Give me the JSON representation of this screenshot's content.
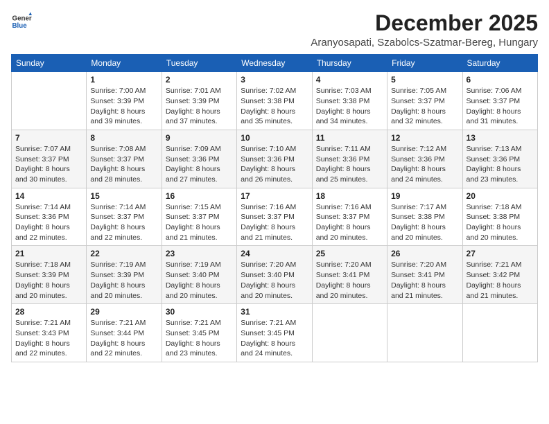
{
  "header": {
    "logo_general": "General",
    "logo_blue": "Blue",
    "month_title": "December 2025",
    "location": "Aranyosapati, Szabolcs-Szatmar-Bereg, Hungary"
  },
  "weekdays": [
    "Sunday",
    "Monday",
    "Tuesday",
    "Wednesday",
    "Thursday",
    "Friday",
    "Saturday"
  ],
  "weeks": [
    [
      {
        "day": "",
        "info": ""
      },
      {
        "day": "1",
        "info": "Sunrise: 7:00 AM\nSunset: 3:39 PM\nDaylight: 8 hours\nand 39 minutes."
      },
      {
        "day": "2",
        "info": "Sunrise: 7:01 AM\nSunset: 3:39 PM\nDaylight: 8 hours\nand 37 minutes."
      },
      {
        "day": "3",
        "info": "Sunrise: 7:02 AM\nSunset: 3:38 PM\nDaylight: 8 hours\nand 35 minutes."
      },
      {
        "day": "4",
        "info": "Sunrise: 7:03 AM\nSunset: 3:38 PM\nDaylight: 8 hours\nand 34 minutes."
      },
      {
        "day": "5",
        "info": "Sunrise: 7:05 AM\nSunset: 3:37 PM\nDaylight: 8 hours\nand 32 minutes."
      },
      {
        "day": "6",
        "info": "Sunrise: 7:06 AM\nSunset: 3:37 PM\nDaylight: 8 hours\nand 31 minutes."
      }
    ],
    [
      {
        "day": "7",
        "info": "Sunrise: 7:07 AM\nSunset: 3:37 PM\nDaylight: 8 hours\nand 30 minutes."
      },
      {
        "day": "8",
        "info": "Sunrise: 7:08 AM\nSunset: 3:37 PM\nDaylight: 8 hours\nand 28 minutes."
      },
      {
        "day": "9",
        "info": "Sunrise: 7:09 AM\nSunset: 3:36 PM\nDaylight: 8 hours\nand 27 minutes."
      },
      {
        "day": "10",
        "info": "Sunrise: 7:10 AM\nSunset: 3:36 PM\nDaylight: 8 hours\nand 26 minutes."
      },
      {
        "day": "11",
        "info": "Sunrise: 7:11 AM\nSunset: 3:36 PM\nDaylight: 8 hours\nand 25 minutes."
      },
      {
        "day": "12",
        "info": "Sunrise: 7:12 AM\nSunset: 3:36 PM\nDaylight: 8 hours\nand 24 minutes."
      },
      {
        "day": "13",
        "info": "Sunrise: 7:13 AM\nSunset: 3:36 PM\nDaylight: 8 hours\nand 23 minutes."
      }
    ],
    [
      {
        "day": "14",
        "info": "Sunrise: 7:14 AM\nSunset: 3:36 PM\nDaylight: 8 hours\nand 22 minutes."
      },
      {
        "day": "15",
        "info": "Sunrise: 7:14 AM\nSunset: 3:37 PM\nDaylight: 8 hours\nand 22 minutes."
      },
      {
        "day": "16",
        "info": "Sunrise: 7:15 AM\nSunset: 3:37 PM\nDaylight: 8 hours\nand 21 minutes."
      },
      {
        "day": "17",
        "info": "Sunrise: 7:16 AM\nSunset: 3:37 PM\nDaylight: 8 hours\nand 21 minutes."
      },
      {
        "day": "18",
        "info": "Sunrise: 7:16 AM\nSunset: 3:37 PM\nDaylight: 8 hours\nand 20 minutes."
      },
      {
        "day": "19",
        "info": "Sunrise: 7:17 AM\nSunset: 3:38 PM\nDaylight: 8 hours\nand 20 minutes."
      },
      {
        "day": "20",
        "info": "Sunrise: 7:18 AM\nSunset: 3:38 PM\nDaylight: 8 hours\nand 20 minutes."
      }
    ],
    [
      {
        "day": "21",
        "info": "Sunrise: 7:18 AM\nSunset: 3:39 PM\nDaylight: 8 hours\nand 20 minutes."
      },
      {
        "day": "22",
        "info": "Sunrise: 7:19 AM\nSunset: 3:39 PM\nDaylight: 8 hours\nand 20 minutes."
      },
      {
        "day": "23",
        "info": "Sunrise: 7:19 AM\nSunset: 3:40 PM\nDaylight: 8 hours\nand 20 minutes."
      },
      {
        "day": "24",
        "info": "Sunrise: 7:20 AM\nSunset: 3:40 PM\nDaylight: 8 hours\nand 20 minutes."
      },
      {
        "day": "25",
        "info": "Sunrise: 7:20 AM\nSunset: 3:41 PM\nDaylight: 8 hours\nand 20 minutes."
      },
      {
        "day": "26",
        "info": "Sunrise: 7:20 AM\nSunset: 3:41 PM\nDaylight: 8 hours\nand 21 minutes."
      },
      {
        "day": "27",
        "info": "Sunrise: 7:21 AM\nSunset: 3:42 PM\nDaylight: 8 hours\nand 21 minutes."
      }
    ],
    [
      {
        "day": "28",
        "info": "Sunrise: 7:21 AM\nSunset: 3:43 PM\nDaylight: 8 hours\nand 22 minutes."
      },
      {
        "day": "29",
        "info": "Sunrise: 7:21 AM\nSunset: 3:44 PM\nDaylight: 8 hours\nand 22 minutes."
      },
      {
        "day": "30",
        "info": "Sunrise: 7:21 AM\nSunset: 3:45 PM\nDaylight: 8 hours\nand 23 minutes."
      },
      {
        "day": "31",
        "info": "Sunrise: 7:21 AM\nSunset: 3:45 PM\nDaylight: 8 hours\nand 24 minutes."
      },
      {
        "day": "",
        "info": ""
      },
      {
        "day": "",
        "info": ""
      },
      {
        "day": "",
        "info": ""
      }
    ]
  ]
}
